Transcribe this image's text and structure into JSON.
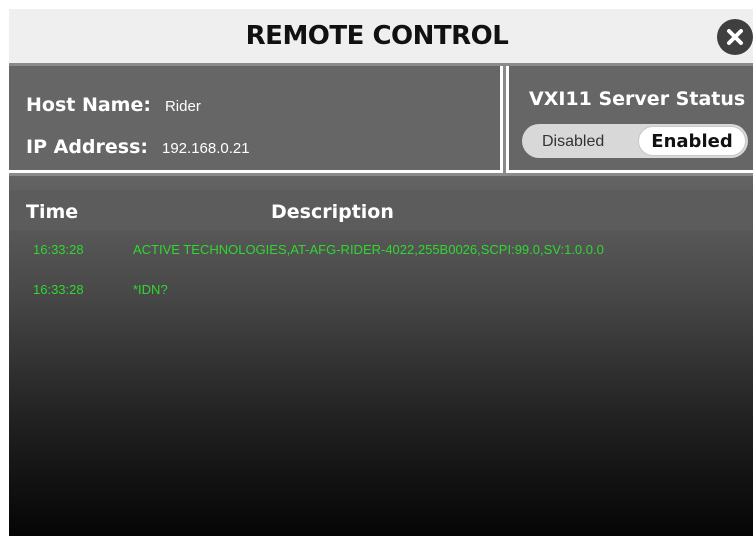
{
  "window": {
    "title": "REMOTE CONTROL",
    "close_icon": "close-icon"
  },
  "info": {
    "host_label": "Host Name:",
    "host_value": "Rider",
    "ip_label": "IP Address:",
    "ip_value": "192.168.0.21"
  },
  "server_status": {
    "title": "VXI11 Server Status",
    "options": [
      "Disabled",
      "Enabled"
    ],
    "selected": "Enabled"
  },
  "log": {
    "columns": [
      "Time",
      "Description"
    ],
    "rows": [
      {
        "time": "16:33:28",
        "description": "ACTIVE TECHNOLOGIES,AT-AFG-RIDER-4022,255B0026,SCPI:99.0,SV:1.0.0.0"
      },
      {
        "time": "16:33:28",
        "description": "*IDN?"
      }
    ]
  },
  "colors": {
    "log_text": "#2fd82f",
    "panel": "#666666",
    "titlebar": "#efefef"
  }
}
